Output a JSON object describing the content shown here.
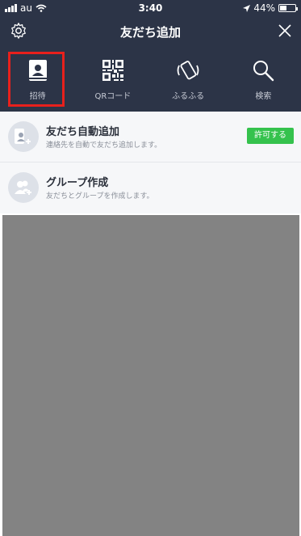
{
  "status_bar": {
    "carrier": "au",
    "time": "3:40",
    "battery": "44%",
    "battery_level": 0.44
  },
  "header": {
    "title": "友だち追加"
  },
  "tabs": [
    {
      "label": "招待",
      "icon": "contact-book-icon"
    },
    {
      "label": "QRコード",
      "icon": "qr-code-icon"
    },
    {
      "label": "ふるふる",
      "icon": "shake-phone-icon"
    },
    {
      "label": "検索",
      "icon": "search-icon"
    }
  ],
  "list": [
    {
      "title": "友だち自動追加",
      "subtitle": "連絡先を自動で友だち追加します。",
      "button": "許可する",
      "icon": "phone-add-friend-icon"
    },
    {
      "title": "グループ作成",
      "subtitle": "友だちとグループを作成します。",
      "icon": "group-add-icon"
    }
  ],
  "colors": {
    "header_bg": "#2c3447",
    "highlight": "#e8201c",
    "allow_button": "#35c24d"
  }
}
